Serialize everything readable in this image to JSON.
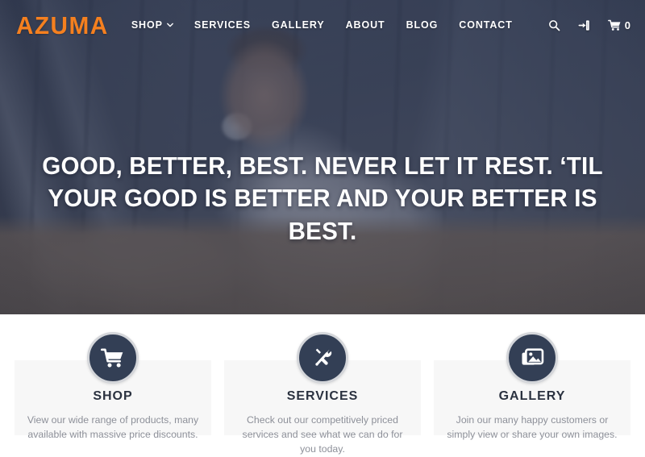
{
  "site": {
    "logo_text": "AZUMA",
    "logo_color": "#f5801f"
  },
  "nav": {
    "items": [
      {
        "label": "SHOP",
        "has_dropdown": true,
        "icon": "chevron-down-icon"
      },
      {
        "label": "SERVICES",
        "has_dropdown": false
      },
      {
        "label": "GALLERY",
        "has_dropdown": false
      },
      {
        "label": "ABOUT",
        "has_dropdown": false
      },
      {
        "label": "BLOG",
        "has_dropdown": false
      },
      {
        "label": "CONTACT",
        "has_dropdown": false
      }
    ],
    "icons": {
      "search": "search-icon",
      "account": "sign-in-icon",
      "cart": "shopping-cart-icon"
    },
    "cart_count": "0"
  },
  "hero": {
    "headline": "Good, better, best. Never let it rest. ‘Til your good is better and your better is best.",
    "overlay_color": "#2e3750",
    "text_color": "#ffffff"
  },
  "features": {
    "circle_color": "#333f55",
    "card_bg": "#f7f7f7",
    "items": [
      {
        "icon": "shopping-cart-icon",
        "title": "Shop",
        "description": "View our wide range of products, many available with massive price discounts."
      },
      {
        "icon": "tools-icon",
        "title": "Services",
        "description": "Check out our competitively priced services and see what we can do for you today."
      },
      {
        "icon": "image-gallery-icon",
        "title": "Gallery",
        "description": "Join our many happy customers or simply view or share your own images."
      }
    ]
  }
}
